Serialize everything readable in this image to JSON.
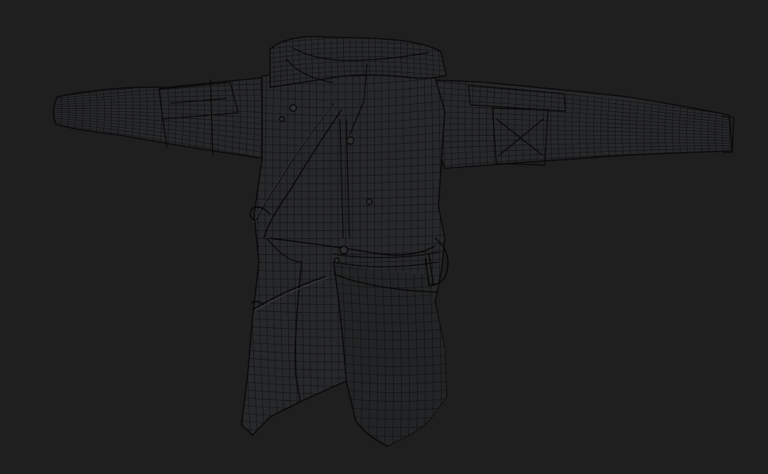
{
  "viewport": {
    "background_color": "#1f1f20",
    "mesh_fill_color": "#27282a",
    "wire_color": "#0c0c0d",
    "display_mode": "wireframe-on-shaded"
  },
  "model": {
    "subject": "coat"
  }
}
